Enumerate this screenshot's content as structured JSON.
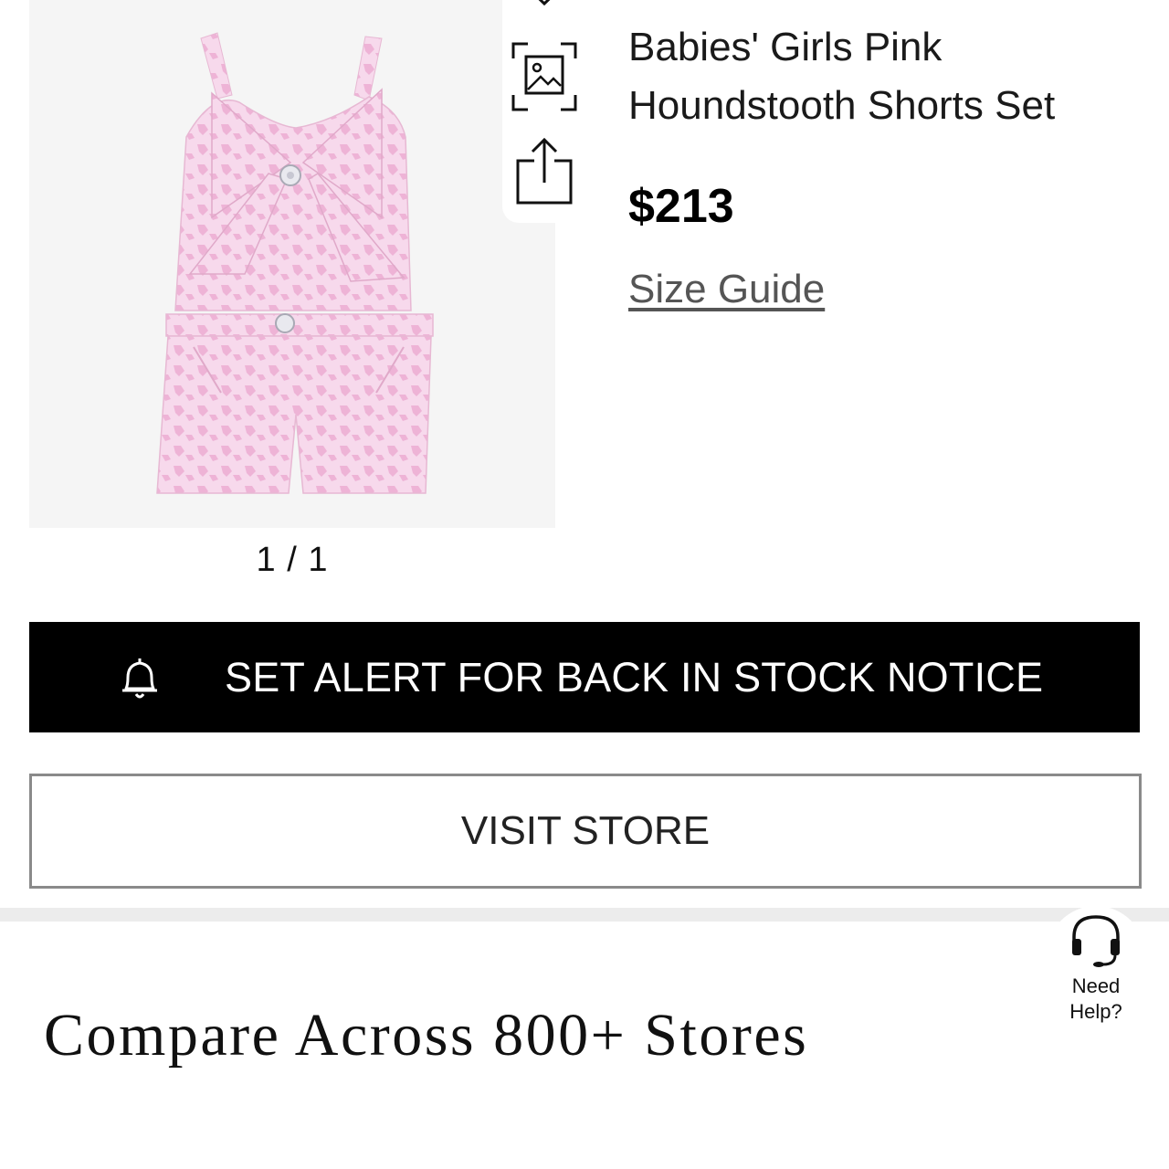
{
  "product": {
    "title": "Babies' Girls Pink Houndstooth Shorts Set",
    "price": "$213",
    "size_guide_label": "Size Guide",
    "image_counter": "1 / 1",
    "image_alt": "Pink houndstooth top with bow and matching shorts"
  },
  "actions": {
    "alert_label": "SET ALERT FOR BACK IN STOCK NOTICE",
    "visit_store_label": "VISIT STORE"
  },
  "icons": {
    "top": "heart-icon",
    "visual_search": "image-search-icon",
    "share": "share-icon",
    "alert": "bell-icon",
    "help": "headset-icon"
  },
  "compare": {
    "heading": "Compare Across 800+ Stores"
  },
  "help": {
    "label": "Need\nHelp?"
  },
  "colors": {
    "alert_bg": "#000000",
    "garment_pink": "#f4c9e3",
    "image_bg": "#f5f5f5"
  }
}
